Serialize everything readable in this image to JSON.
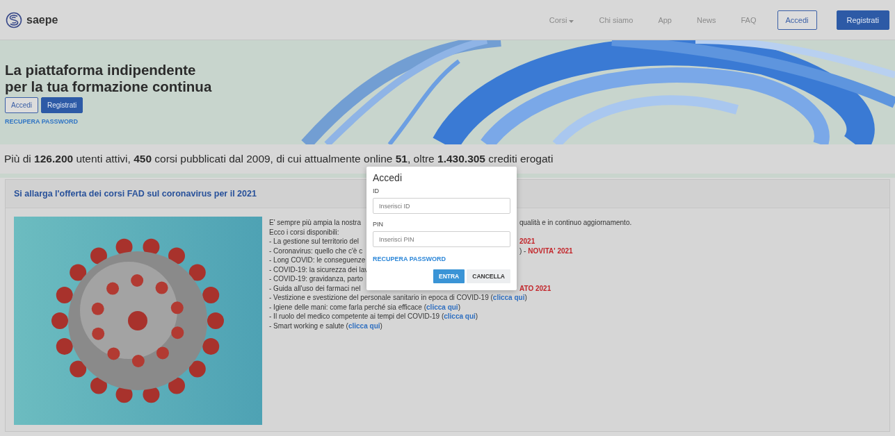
{
  "navbar": {
    "brand": "saepe",
    "items": [
      {
        "label": "Corsi",
        "kind": "dropdown"
      },
      {
        "label": "Chi siamo",
        "kind": "link"
      },
      {
        "label": "App",
        "kind": "link"
      },
      {
        "label": "News",
        "kind": "link"
      },
      {
        "label": "FAQ",
        "kind": "link"
      },
      {
        "label": "Accedi",
        "kind": "outline"
      },
      {
        "label": "Registrati",
        "kind": "primary"
      }
    ]
  },
  "hero": {
    "title": [
      "La piattaforma indipendente",
      "per la tua formazione continua"
    ],
    "buttons": [
      {
        "label": "Accedi",
        "kind": "outline"
      },
      {
        "label": "Registrati",
        "kind": "primary"
      }
    ],
    "link": "RECUPERA PASSWORD"
  },
  "stats": "Più di **126.200** utenti attivi, **450** corsi pubblicati dal 2009, di cui attualmente online **51**, oltre **1.430.305** crediti erogati",
  "article": {
    "title": "Si allarga l'offerta dei corsi FAD sul coronavirus per il 2021",
    "lines": [
      {
        "left": [
          {
            "text": "E' sempre più ampia la nostra",
            "kind": "text"
          }
        ],
        "right": [
          {
            "text": "qualità e in continuo aggiornamento.",
            "kind": "text"
          }
        ]
      },
      {
        "left": [
          {
            "text": "Ecco i corsi disponibili:",
            "kind": "text"
          }
        ]
      },
      {
        "left": [
          {
            "text": "- La gestione sul territorio del",
            "kind": "text"
          }
        ],
        "right": [
          {
            "text": "2021",
            "kind": "new"
          }
        ]
      },
      {
        "left": [
          {
            "text": "- Coronavirus: quello che c'è c",
            "kind": "text"
          }
        ],
        "right": [
          {
            "text": ") - ",
            "kind": "text"
          },
          {
            "text": "NOVITA' 2021",
            "kind": "new"
          }
        ]
      },
      {
        "left": [
          {
            "text": "- Long COVID: le conseguenze",
            "kind": "text"
          }
        ]
      },
      {
        "left": [
          {
            "text": "- COVID-19: la sicurezza dei lav",
            "kind": "text"
          }
        ]
      },
      {
        "left": [
          {
            "text": "- COVID-19: gravidanza, parto",
            "kind": "text"
          }
        ]
      },
      {
        "left": [
          {
            "text": "- Guida all'uso dei farmaci nel",
            "kind": "text"
          }
        ],
        "right": [
          {
            "text": "ATO 2021",
            "kind": "new"
          }
        ]
      },
      {
        "left": [
          {
            "text": "- Vestizione e svestizione del personale sanitario in epoca di COVID-19 (",
            "kind": "text"
          },
          {
            "text": "clicca qui",
            "kind": "link"
          },
          {
            "text": ")",
            "kind": "text"
          }
        ]
      },
      {
        "left": [
          {
            "text": "- Igiene delle mani: come farla perché sia efficace (",
            "kind": "text"
          },
          {
            "text": "clicca qui",
            "kind": "link"
          },
          {
            "text": ")",
            "kind": "text"
          }
        ]
      },
      {
        "left": [
          {
            "text": "- Il ruolo del medico competente ai tempi del COVID-19 (",
            "kind": "text"
          },
          {
            "text": "clicca qui",
            "kind": "link"
          },
          {
            "text": ")",
            "kind": "text"
          }
        ]
      },
      {
        "left": [
          {
            "text": "- Smart working e salute (",
            "kind": "text"
          },
          {
            "text": "clicca qui",
            "kind": "link"
          },
          {
            "text": ")",
            "kind": "text"
          }
        ]
      }
    ]
  },
  "modal": {
    "title": "Accedi",
    "fields": [
      {
        "label": "ID",
        "placeholder": "Inserisci ID"
      },
      {
        "label": "PIN",
        "placeholder": "Inserisci PIN"
      }
    ],
    "link": "RECUPERA PASSWORD",
    "buttons": [
      {
        "label": "ENTRA",
        "kind": "primary"
      },
      {
        "label": "CANCELLA",
        "kind": "secondary"
      }
    ]
  }
}
